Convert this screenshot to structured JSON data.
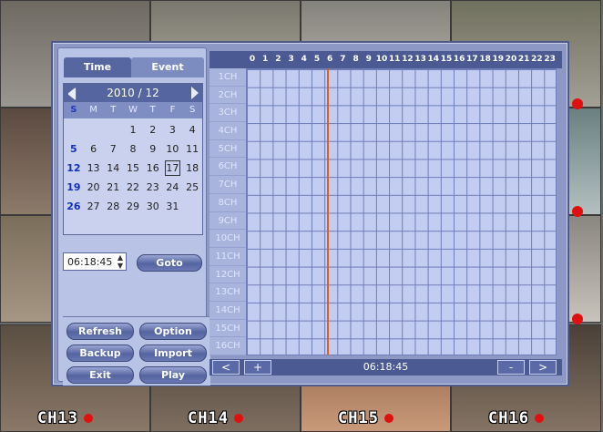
{
  "tabs": {
    "time": "Time",
    "event": "Event"
  },
  "calendar": {
    "month_label": "2010 / 12",
    "weekdays": [
      "S",
      "M",
      "T",
      "W",
      "T",
      "F",
      "S"
    ],
    "days": [
      "",
      "",
      "",
      "1",
      "2",
      "3",
      "4",
      "5",
      "6",
      "7",
      "8",
      "9",
      "10",
      "11",
      "12",
      "13",
      "14",
      "15",
      "16",
      "17",
      "18",
      "19",
      "20",
      "21",
      "22",
      "23",
      "24",
      "25",
      "26",
      "27",
      "28",
      "29",
      "30",
      "31",
      ""
    ],
    "selected_day": "17"
  },
  "time_field": {
    "value": "06:18:45"
  },
  "buttons": {
    "goto": "Goto",
    "refresh": "Refresh",
    "option": "Option",
    "backup": "Backup",
    "import": "Import",
    "exit": "Exit",
    "play": "Play"
  },
  "timeline": {
    "hours": [
      "0",
      "1",
      "2",
      "3",
      "4",
      "5",
      "6",
      "7",
      "8",
      "9",
      "10",
      "11",
      "12",
      "13",
      "14",
      "15",
      "16",
      "17",
      "18",
      "19",
      "20",
      "21",
      "22",
      "23"
    ],
    "channels": [
      "1CH",
      "2CH",
      "3CH",
      "4CH",
      "5CH",
      "6CH",
      "7CH",
      "8CH",
      "9CH",
      "10CH",
      "11CH",
      "12CH",
      "13CH",
      "14CH",
      "15CH",
      "16CH"
    ],
    "cursor_hour": 6.3,
    "current_time": "06:18:45",
    "nav_prev": "<",
    "zoom_in": "+",
    "zoom_out": "-",
    "nav_next": ">",
    "cursor_color": "#e06020"
  },
  "cameras": {
    "bottom": [
      {
        "label": "CH13"
      },
      {
        "label": "CH14"
      },
      {
        "label": "CH15"
      },
      {
        "label": "CH16"
      }
    ]
  }
}
